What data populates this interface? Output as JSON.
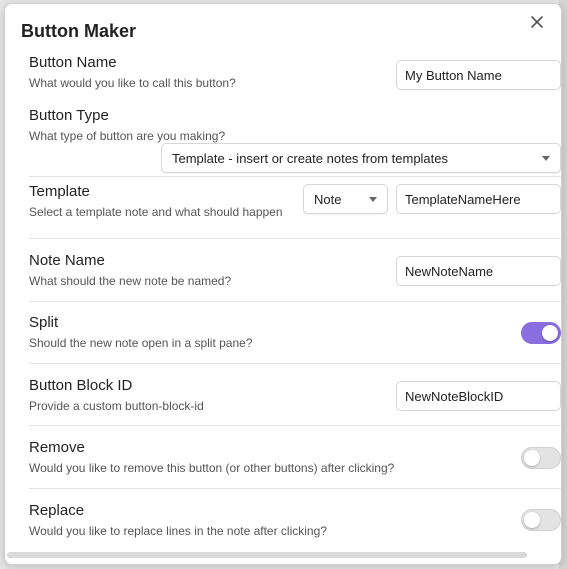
{
  "modal": {
    "title": "Button Maker"
  },
  "settings": {
    "button_name": {
      "label": "Button Name",
      "description": "What would you like to call this button?",
      "value": "My Button Name"
    },
    "button_type": {
      "label": "Button Type",
      "description": "What type of button are you making?",
      "selected": "Template - insert or create notes from templates"
    },
    "template": {
      "label": "Template",
      "description": "Select a template note and what should happen",
      "mode_selected": "Note",
      "value": "TemplateNameHere"
    },
    "note_name": {
      "label": "Note Name",
      "description": "What should the new note be named?",
      "value": "NewNoteName"
    },
    "split": {
      "label": "Split",
      "description": "Should the new note open in a split pane?",
      "enabled": true
    },
    "block_id": {
      "label": "Button Block ID",
      "description": "Provide a custom button-block-id",
      "value": "NewNoteBlockID"
    },
    "remove": {
      "label": "Remove",
      "description": "Would you like to remove this button (or other buttons) after clicking?",
      "enabled": false
    },
    "replace": {
      "label": "Replace",
      "description": "Would you like to replace lines in the note after clicking?",
      "enabled": false
    }
  },
  "colors": {
    "accent": "#8a6ee0"
  },
  "icons": {
    "close": "close-icon",
    "dropdown": "chevron-down-icon"
  }
}
